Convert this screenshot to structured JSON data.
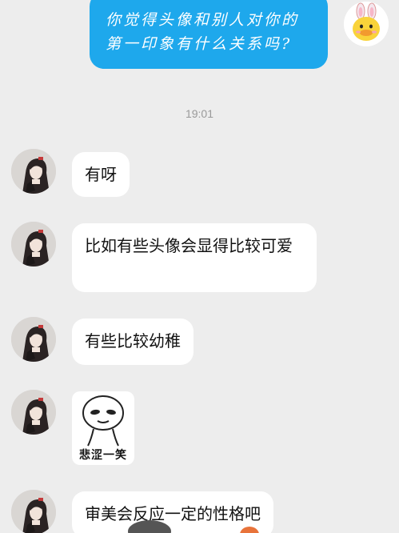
{
  "outgoing": {
    "text": "你觉得头像和别人对你的第一印象有什么关系吗?"
  },
  "timestamp": "19:01",
  "incoming": [
    {
      "text": "有呀"
    },
    {
      "text": "比如有些头像会显得比较可爱"
    },
    {
      "text": "有些比较幼稚"
    },
    {
      "sticker_caption": "悲涩一笑"
    },
    {
      "text": "审美会反应一定的性格吧"
    }
  ],
  "colors": {
    "background": "#ededed",
    "outgoing_bubble": "#1ea8ec",
    "incoming_bubble": "#ffffff"
  },
  "icons": {
    "my_avatar": "duck-bunny-avatar-icon",
    "contact_avatar": "girl-portrait-avatar-icon"
  }
}
